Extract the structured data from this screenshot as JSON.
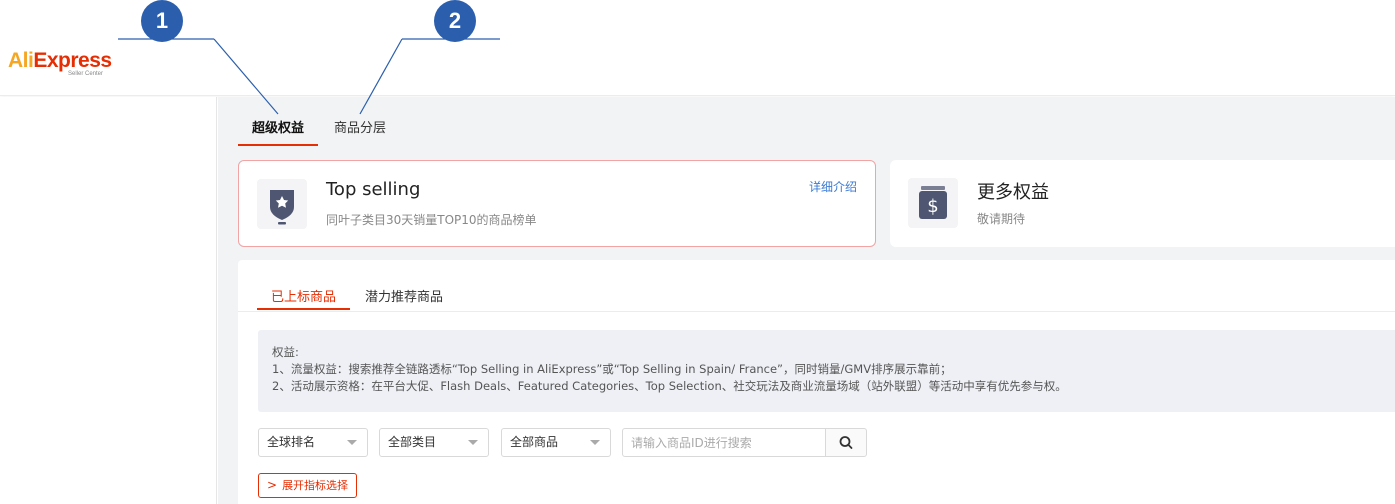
{
  "header": {
    "logo_ali": "Ali",
    "logo_express": "Express",
    "logo_sub": "Seller Center"
  },
  "callouts": [
    {
      "number": "1"
    },
    {
      "number": "2"
    }
  ],
  "top_tabs": [
    {
      "label": "超级权益",
      "active": true
    },
    {
      "label": "商品分层",
      "active": false
    }
  ],
  "cards": {
    "top_selling": {
      "title": "Top selling",
      "subtitle": "同叶子类目30天销量TOP10的商品榜单",
      "link": "详细介绍",
      "icon": "shield-medal-icon"
    },
    "more_benefits": {
      "title": "更多权益",
      "subtitle": "敬请期待",
      "icon": "dollar-box-icon"
    }
  },
  "sub_tabs": [
    {
      "label": "已上标商品",
      "active": true
    },
    {
      "label": "潜力推荐商品",
      "active": false
    }
  ],
  "notice": {
    "heading": "权益:",
    "line1": "1、流量权益：搜索推荐全链路透标“Top Selling in AliExpress”或“Top Selling in Spain/ France”，同时销量/GMV排序展示靠前；",
    "line2": "2、活动展示资格：在平台大促、Flash Deals、Featured Categories、Top Selection、社交玩法及商业流量场域（站外联盟）等活动中享有优先参与权。"
  },
  "filters": {
    "ranking": "全球排名",
    "category": "全部类目",
    "products": "全部商品",
    "search_placeholder": "请输入商品ID进行搜索"
  },
  "expand_button": "展开指标选择",
  "colors": {
    "accent": "#e62e04",
    "callout": "#2b5fad",
    "link": "#3a7bd5"
  }
}
